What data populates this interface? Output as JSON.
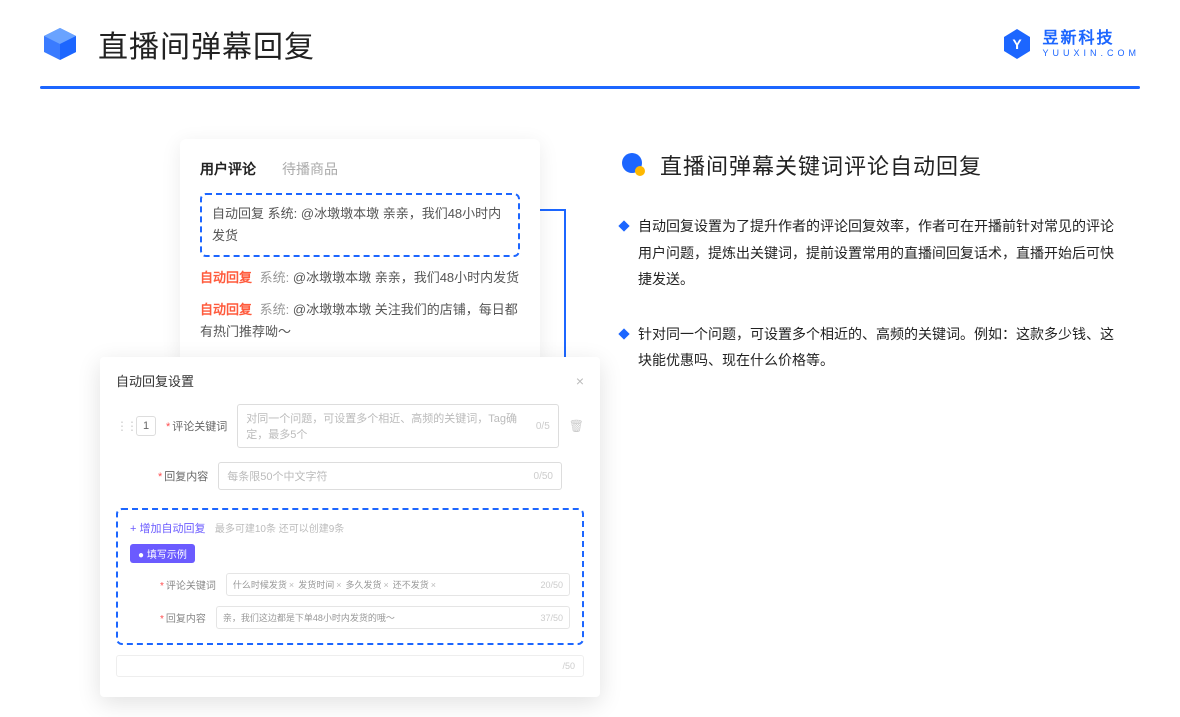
{
  "header": {
    "title": "直播间弹幕回复"
  },
  "logo": {
    "cn": "昱新科技",
    "en": "YUUXIN.COM"
  },
  "card1": {
    "tabs": {
      "active": "用户评论",
      "inactive": "待播商品"
    },
    "highlight": {
      "tag": "自动回复",
      "sys": "系统:",
      "text": "@冰墩墩本墩 亲亲，我们48小时内发货"
    },
    "rows": [
      {
        "tag": "自动回复",
        "sys": "系统:",
        "text": "@冰墩墩本墩 亲亲，我们48小时内发货"
      },
      {
        "tag": "自动回复",
        "sys": "系统:",
        "text": "@冰墩墩本墩 关注我们的店铺，每日都有热门推荐呦～"
      }
    ]
  },
  "card2": {
    "title": "自动回复设置",
    "close": "×",
    "idx": "1",
    "kw_label": "评论关键词",
    "kw_placeholder": "对同一个问题，可设置多个相近、高频的关键词，Tag确定，最多5个",
    "kw_count": "0/5",
    "content_label": "回复内容",
    "content_placeholder": "每条限50个中文字符",
    "content_count": "0/50",
    "trash": "🗑",
    "add_link": "+ 增加自动回复",
    "add_hint": "最多可建10条 还可以创建9条",
    "example_pill": "● 填写示例",
    "ex_kw_label": "评论关键词",
    "ex_chips": [
      "什么时候发货",
      "发货时间",
      "多久发货",
      "还不发货"
    ],
    "ex_kw_count": "20/50",
    "ex_content_label": "回复内容",
    "ex_content_val": "亲，我们这边都是下单48小时内发货的哦～",
    "ex_content_count": "37/50",
    "ghost_count": "/50"
  },
  "right": {
    "title": "直播间弹幕关键词评论自动回复",
    "bullets": [
      "自动回复设置为了提升作者的评论回复效率，作者可在开播前针对常见的评论用户问题，提炼出关键词，提前设置常用的直播间回复话术，直播开始后可快捷发送。",
      "针对同一个问题，可设置多个相近的、高频的关键词。例如：这款多少钱、这块能优惠吗、现在什么价格等。"
    ]
  }
}
